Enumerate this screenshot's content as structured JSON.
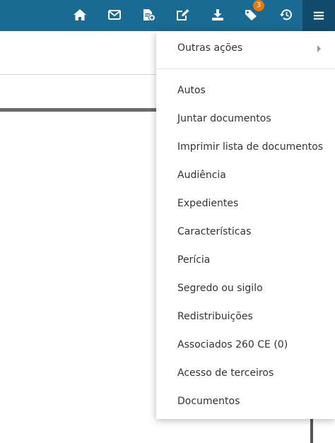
{
  "toolbar": {
    "icons": [
      "home-icon",
      "envelope-icon",
      "document-plus-icon",
      "edit-icon",
      "download-icon",
      "tags-icon",
      "history-icon",
      "menu-icon"
    ],
    "tags_badge": "3",
    "accent": "#1a6b94",
    "badge_color": "#e8790e"
  },
  "menu": {
    "other_actions": "Outras ações",
    "items": [
      "Autos",
      "Juntar documentos",
      "Imprimir lista de documentos",
      "Audiência",
      "Expedientes",
      "Características",
      "Perícia",
      "Segredo ou sigilo",
      "Redistribuições",
      "Associados 260 CE (0)",
      "Acesso de terceiros",
      "Documentos"
    ]
  }
}
